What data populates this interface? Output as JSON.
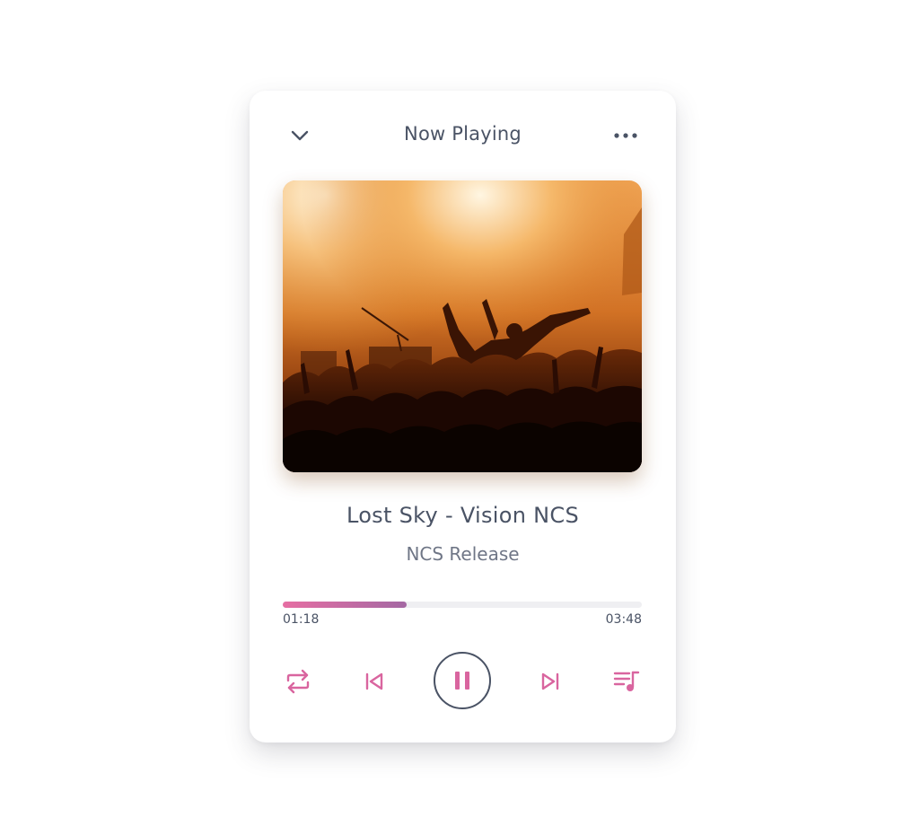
{
  "header": {
    "title": "Now Playing",
    "collapse_icon": "chevron-down-icon",
    "more_icon": "more-horizontal-icon"
  },
  "track": {
    "title": "Lost Sky - Vision NCS",
    "artist": "NCS Release",
    "cover": "concert-crowd-image"
  },
  "progress": {
    "current": "01:18",
    "total": "03:48",
    "fraction": 0.346
  },
  "controls": {
    "repeat_icon": "repeat-icon",
    "prev_icon": "skip-previous-icon",
    "play_pause_icon": "pause-icon",
    "next_icon": "skip-next-icon",
    "queue_icon": "playlist-icon"
  },
  "colors": {
    "accent": "#d9659f",
    "accent_end": "#a468a3",
    "text_primary": "#4a5365",
    "text_secondary": "#6f7686",
    "track_bg": "#efeff2"
  }
}
